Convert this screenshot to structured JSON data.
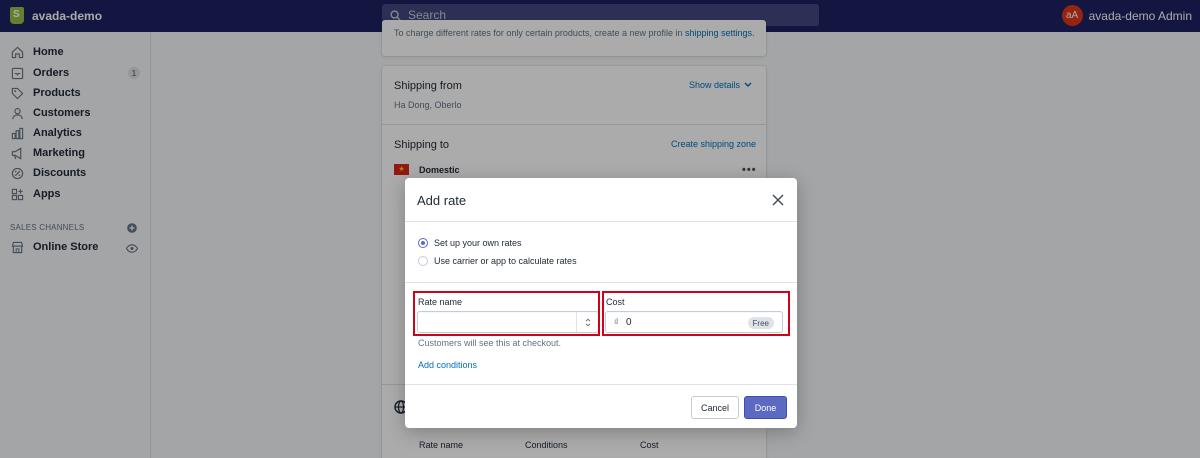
{
  "topbar": {
    "store_name": "avada-demo",
    "search_placeholder": "Search",
    "avatar_initials": "aA",
    "account_name": "avada-demo Admin"
  },
  "sidebar": {
    "items": [
      {
        "label": "Home",
        "icon": "home-icon"
      },
      {
        "label": "Orders",
        "icon": "orders-icon",
        "badge": "1"
      },
      {
        "label": "Products",
        "icon": "tag-icon"
      },
      {
        "label": "Customers",
        "icon": "person-icon"
      },
      {
        "label": "Analytics",
        "icon": "bar-chart-icon"
      },
      {
        "label": "Marketing",
        "icon": "megaphone-icon"
      },
      {
        "label": "Discounts",
        "icon": "discount-icon"
      },
      {
        "label": "Apps",
        "icon": "apps-icon"
      }
    ],
    "channels_label": "SALES CHANNELS",
    "online_store": "Online Store"
  },
  "page": {
    "top_note": "To charge different rates for only certain products, create a new profile in",
    "top_note_link": "shipping settings.",
    "shipping_from_title": "Shipping from",
    "show_details": "Show details",
    "shipping_from_address": "Ha Dong, Oberlo",
    "shipping_to_title": "Shipping to",
    "create_zone": "Create shipping zone",
    "zone_name": "Domestic",
    "table_headers": [
      "Rate name",
      "Conditions",
      "Cost"
    ]
  },
  "modal": {
    "title": "Add rate",
    "option_own": "Set up your own rates",
    "option_carrier": "Use carrier or app to calculate rates",
    "selected_option": "own",
    "rate_name_label": "Rate name",
    "rate_name_value": "",
    "cost_label": "Cost",
    "currency_symbol": "₫",
    "cost_value": "0",
    "free_badge": "Free",
    "help_text": "Customers will see this at checkout.",
    "add_conditions": "Add conditions",
    "cancel": "Cancel",
    "done": "Done"
  },
  "colors": {
    "topbar": "#1c2260",
    "primary": "#5c6ac4",
    "link": "#006fbb",
    "highlight": "#d0021b"
  }
}
